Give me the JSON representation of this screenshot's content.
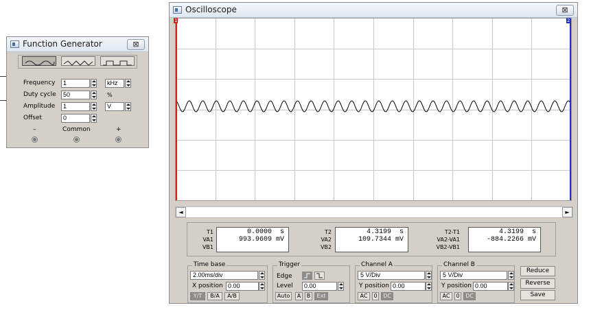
{
  "function_generator": {
    "title": "Function Generator",
    "close_glyph": "⊠",
    "waveforms": [
      "sine",
      "triangle",
      "square"
    ],
    "selected_waveform": "sine",
    "frequency_label": "Frequency",
    "frequency_value": "1",
    "frequency_unit": "kHz",
    "duty_cycle_label": "Duty cycle",
    "duty_cycle_value": "50",
    "duty_cycle_unit": "%",
    "amplitude_label": "Amplitude",
    "amplitude_value": "1",
    "amplitude_unit": "V",
    "offset_label": "Offset",
    "offset_value": "0",
    "terminal_minus": "–",
    "terminal_common": "Common",
    "terminal_plus": "+"
  },
  "oscilloscope": {
    "title": "Oscilloscope",
    "close_glyph": "⊠",
    "cursor1_label": "1",
    "cursor2_label": "2",
    "scroll_left": "◄",
    "scroll_right": "►",
    "readout": {
      "t1_label": "T1",
      "va1_label": "VA1",
      "vb1_label": "VB1",
      "t1_value": "0.0000",
      "t1_unit": "s",
      "va1_value": "993.9609",
      "va1_unit": "mV",
      "t2_label": "T2",
      "va2_label": "VA2",
      "vb2_label": "VB2",
      "t2_value": "4.3199",
      "t2_unit": "s",
      "va2_value": "109.7344",
      "va2_unit": "mV",
      "d_t_label": "T2-T1",
      "d_va_label": "VA2-VA1",
      "d_vb_label": "VB2-VB1",
      "d_t_value": "4.3199",
      "d_t_unit": "s",
      "d_va_value": "-884.2266",
      "d_va_unit": "mV"
    },
    "timebase": {
      "title": "Time base",
      "value": "2.00ms/div",
      "xpos_label": "X position",
      "xpos_value": "0.00",
      "modes": [
        "Y/T",
        "B/A",
        "A/B"
      ]
    },
    "trigger": {
      "title": "Trigger",
      "edge_label": "Edge",
      "level_label": "Level",
      "level_value": "0.00",
      "modes": [
        "Auto",
        "A",
        "B",
        "Ext"
      ]
    },
    "channel_a": {
      "title": "Channel A",
      "value": "5 V/Div",
      "ypos_label": "Y position",
      "ypos_value": "0.00",
      "coupling": [
        "AC",
        "0",
        "DC"
      ]
    },
    "channel_b": {
      "title": "Channel B",
      "value": "5 V/Div",
      "ypos_label": "Y position",
      "ypos_value": "0.00",
      "coupling": [
        "AC",
        "0",
        "DC"
      ]
    },
    "buttons": {
      "reduce": "Reduce",
      "reverse": "Reverse",
      "save": "Save"
    },
    "colors": {
      "cursor1": "#d32020",
      "cursor2": "#1e2fc2",
      "trace": "#000000",
      "grid": "#c8c8c8"
    }
  }
}
